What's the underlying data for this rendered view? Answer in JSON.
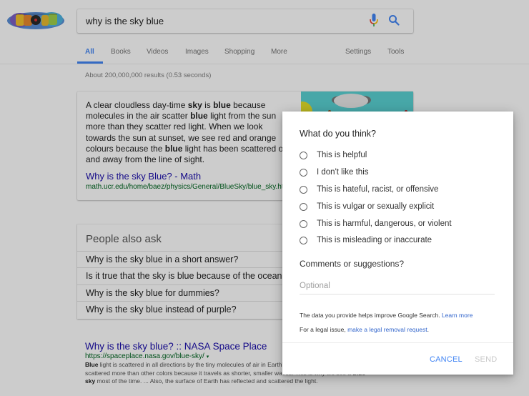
{
  "header": {
    "logo_alt": "Google Doodle",
    "search_query": "why is the sky blue",
    "mic_icon": "microphone-icon",
    "search_icon": "magnifier-icon"
  },
  "tabs": [
    {
      "label": "All",
      "active": true
    },
    {
      "label": "Books"
    },
    {
      "label": "Videos"
    },
    {
      "label": "Images"
    },
    {
      "label": "Shopping"
    },
    {
      "label": "More"
    },
    {
      "label": "Settings"
    },
    {
      "label": "Tools"
    }
  ],
  "stats": "About 200,000,000 results (0.53 seconds)",
  "featured_snippet": {
    "lines": [
      [
        "A clear cloudless day-time ",
        {
          "b": "sky"
        },
        " is ",
        {
          "b": "blue"
        },
        " because"
      ],
      [
        "molecules in the air scatter ",
        {
          "b": "blue"
        },
        " light from the sun"
      ],
      [
        "more than they scatter red light. When we look"
      ],
      [
        "towards the sun at sunset, we see red and orange"
      ],
      [
        "colours because the ",
        {
          "b": "blue"
        },
        " light has been scattered out"
      ],
      [
        "and away from the line of sight."
      ]
    ],
    "link_title": "Why is the sky Blue? - Math",
    "url": "math.ucr.edu/home/baez/physics/General/BlueSky/blue_sky.html"
  },
  "people_also_ask": {
    "title": "People also ask",
    "questions": [
      "Why is the sky blue in a short answer?",
      "Is it true that the sky is blue because of the ocean?",
      "Why is the sky blue for dummies?",
      "Why is the sky blue instead of purple?"
    ]
  },
  "result": {
    "title": "Why is the sky blue? :: NASA Space Place",
    "url": "https://spaceplace.nasa.gov/blue-sky/",
    "url_caret": "▾",
    "desc_lines": [
      [
        {
          "b": "Blue"
        },
        " light is scattered in all directions by the tiny molecules of air in Earth's atmosphere. Blue is"
      ],
      [
        "scattered more than other colors because it travels as shorter, smaller waves. This is why we see a ",
        {
          "b": "blue"
        }
      ],
      [
        {
          "b": "sky"
        },
        " most of the time. ... Also, the surface of Earth has reflected and scattered the light."
      ]
    ]
  },
  "feedback_dialog": {
    "title": "What do you think?",
    "options": [
      "This is helpful",
      "I don't like this",
      "This is hateful, racist, or offensive",
      "This is vulgar or sexually explicit",
      "This is harmful, dangerous, or violent",
      "This is misleading or inaccurate"
    ],
    "comments_label": "Comments or suggestions?",
    "comments_placeholder": "Optional",
    "comments_value": "",
    "info_text": "The data you provide helps improve Google Search. ",
    "info_link": "Learn more",
    "legal_text": "For a legal issue, ",
    "legal_link": "make a legal removal request",
    "legal_suffix": ".",
    "cancel_label": "CANCEL",
    "send_label": "SEND"
  },
  "colors": {
    "accent": "#4285f4",
    "link": "#1a0dab",
    "url_green": "#006621",
    "disabled": "#c8c8c8"
  }
}
